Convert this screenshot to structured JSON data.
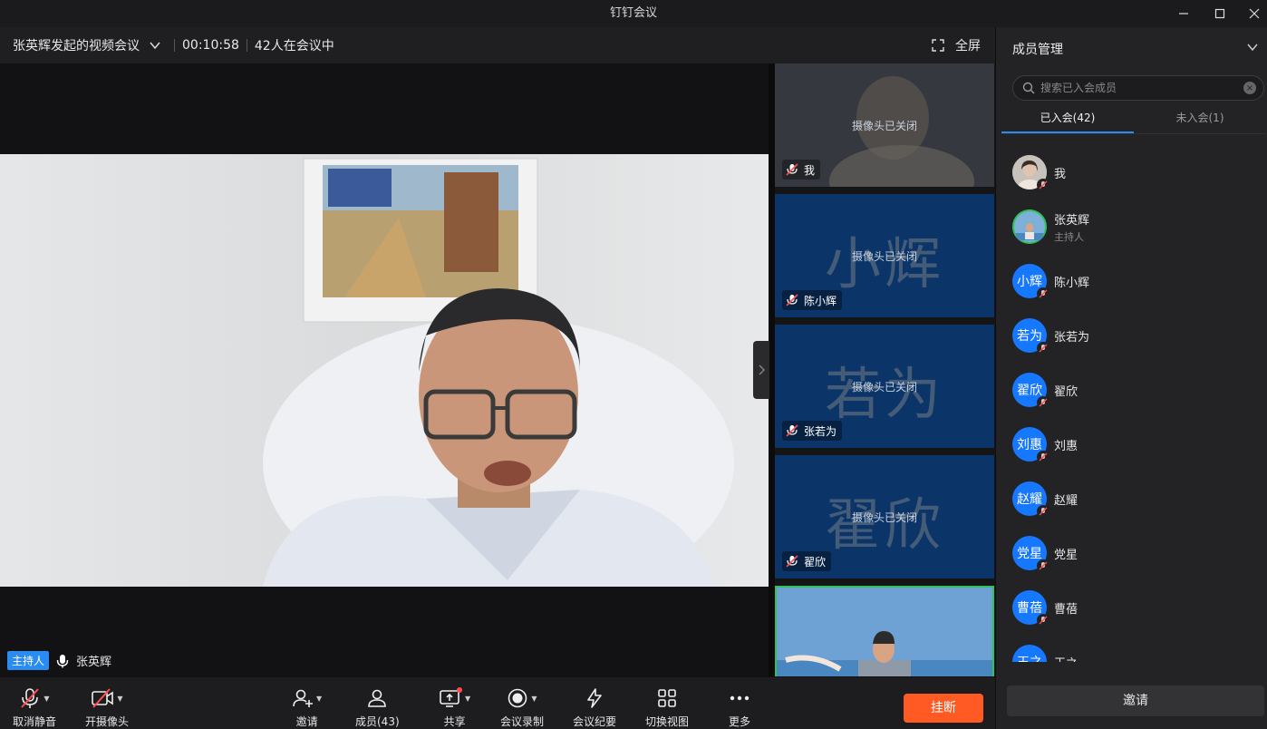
{
  "window": {
    "title": "钉钉会议"
  },
  "infobar": {
    "meeting_title": "张英辉发起的视频会议",
    "duration": "00:10:58",
    "participants_text": "42人在会议中",
    "fullscreen_label": "全屏"
  },
  "stage": {
    "host_badge": "主持人",
    "host_name": "张英辉"
  },
  "tiles": [
    {
      "avatar_text": "",
      "status": "摄像头已关闭",
      "name": "我"
    },
    {
      "avatar_text": "小辉",
      "status": "摄像头已关闭",
      "name": "陈小辉"
    },
    {
      "avatar_text": "若为",
      "status": "摄像头已关闭",
      "name": "张若为"
    },
    {
      "avatar_text": "翟欣",
      "status": "摄像头已关闭",
      "name": "翟欣"
    }
  ],
  "panel": {
    "title": "成员管理",
    "search_placeholder": "搜索已入会成员",
    "tabs": [
      "已入会(42)",
      "未入会(1)"
    ],
    "members": [
      {
        "avatar": "",
        "name": "我",
        "role": ""
      },
      {
        "avatar": "",
        "name": "张英辉",
        "role": "主持人"
      },
      {
        "avatar": "小辉",
        "name": "陈小辉",
        "role": ""
      },
      {
        "avatar": "若为",
        "name": "张若为",
        "role": ""
      },
      {
        "avatar": "翟欣",
        "name": "翟欣",
        "role": ""
      },
      {
        "avatar": "刘惠",
        "name": "刘惠",
        "role": ""
      },
      {
        "avatar": "赵耀",
        "name": "赵耀",
        "role": ""
      },
      {
        "avatar": "党星",
        "name": "党星",
        "role": ""
      },
      {
        "avatar": "曹蓓",
        "name": "曹蓓",
        "role": ""
      },
      {
        "avatar": "王之",
        "name": "王之",
        "role": ""
      }
    ],
    "invite_label": "邀请"
  },
  "toolbar": {
    "unmute": "取消静音",
    "camera": "开摄像头",
    "invite": "邀请",
    "members": "成员(43)",
    "share": "共享",
    "record": "会议录制",
    "minutes": "会议纪要",
    "switch_view": "切换视图",
    "more": "更多",
    "hangup": "挂断"
  },
  "colors": {
    "accent": "#2a8cf0",
    "hangup": "#ff5a24",
    "active_tile": "#2fc25b",
    "avatar_blue": "#1677ff"
  }
}
